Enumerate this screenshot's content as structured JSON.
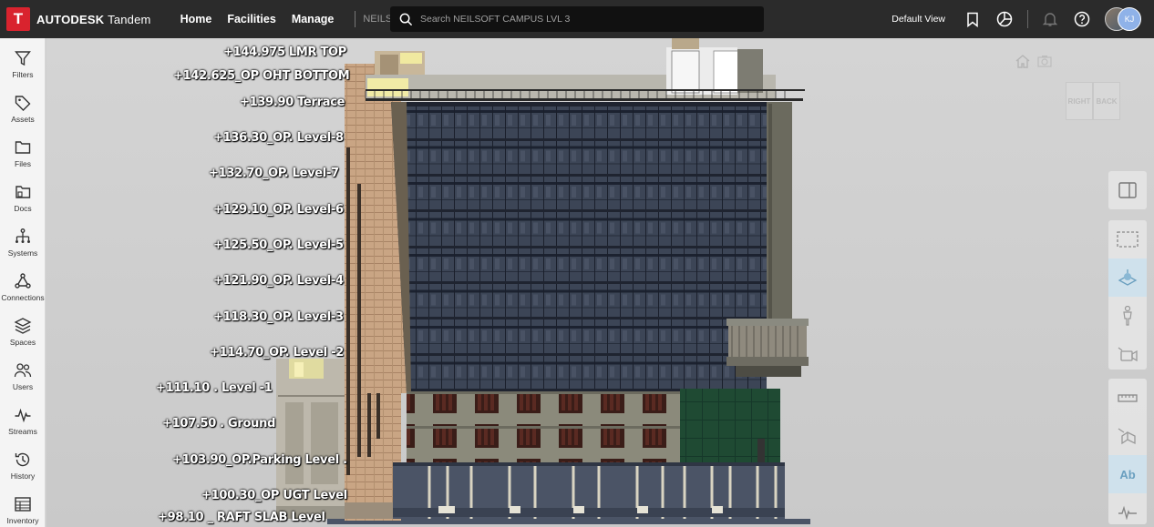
{
  "topbar": {
    "brand_logo": "T",
    "brand_bold": "AUTODESK",
    "brand_light": "Tandem",
    "nav": [
      "Home",
      "Facilities",
      "Manage"
    ],
    "crumb": "NEILSO...",
    "search_placeholder": "Search NEILSOFT CAMPUS LVL 3",
    "view_label": "Default View",
    "icons": [
      "bookmark-icon",
      "dashboard-icon",
      "bell-icon",
      "help-icon"
    ],
    "avatar_initials": "KJ"
  },
  "sidebar": {
    "items": [
      {
        "label": "Filters",
        "icon": "filter-icon"
      },
      {
        "label": "Assets",
        "icon": "tag-icon"
      },
      {
        "label": "Files",
        "icon": "folder-icon"
      },
      {
        "label": "Docs",
        "icon": "docs-icon"
      },
      {
        "label": "Systems",
        "icon": "systems-icon"
      },
      {
        "label": "Connections",
        "icon": "connections-icon"
      },
      {
        "label": "Spaces",
        "icon": "layers-icon"
      },
      {
        "label": "Users",
        "icon": "users-icon"
      },
      {
        "label": "Streams",
        "icon": "streams-icon"
      },
      {
        "label": "History",
        "icon": "history-icon"
      },
      {
        "label": "Inventory",
        "icon": "table-icon"
      }
    ]
  },
  "viewcube": {
    "right": "RIGHT",
    "back": "BACK"
  },
  "levels": [
    {
      "label": "+144.975 LMR TOP"
    },
    {
      "label": "+142.625_OP OHT BOTTOM"
    },
    {
      "label": "+139.90 Terrace"
    },
    {
      "label": "+136.30_OP. Level-8"
    },
    {
      "label": "+132.70_OP. Level-7"
    },
    {
      "label": "+129.10_OP. Level-6"
    },
    {
      "label": "+125.50_OP. Level-5"
    },
    {
      "label": "+121.90_OP. Level-4"
    },
    {
      "label": "+118.30_OP. Level-3"
    },
    {
      "label": "+114.70_OP. Level -2"
    },
    {
      "label": "+111.10 . Level -1"
    },
    {
      "label": "+107.50 . Ground"
    },
    {
      "label": "+103.90_OP.Parking Level ."
    },
    {
      "label": "+100.30_OP UGT Level"
    },
    {
      "label": "+98.10 _ RAFT SLAB Level"
    }
  ],
  "right_tools": {
    "text_tool_label": "Ab",
    "icons": [
      "panel-toggle-icon",
      "box-select-icon",
      "section-icon",
      "person-icon",
      "camera-icon",
      "measure-icon",
      "model-icon",
      "text-icon",
      "chart-line-icon"
    ]
  }
}
